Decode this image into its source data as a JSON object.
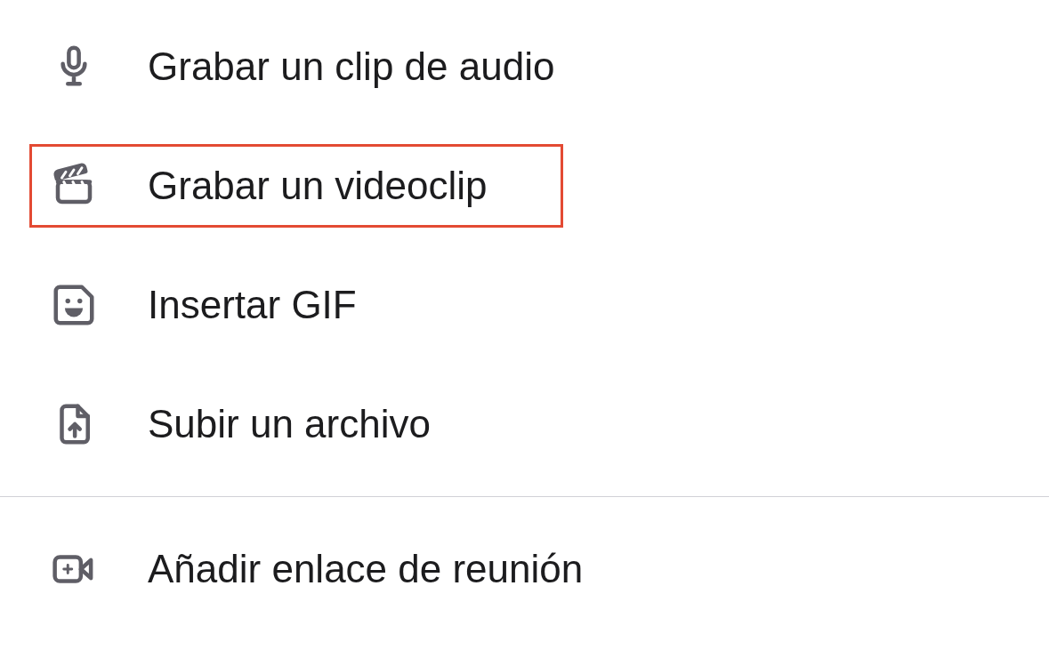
{
  "menu_groups": [
    {
      "items": [
        {
          "kind": "microphone",
          "label": "Grabar un clip de audio",
          "highlighted": false
        },
        {
          "kind": "clapperboard",
          "label": "Grabar un videoclip",
          "highlighted": true
        },
        {
          "kind": "gif",
          "label": "Insertar GIF",
          "highlighted": false
        },
        {
          "kind": "upload",
          "label": "Subir un archivo",
          "highlighted": false
        }
      ]
    },
    {
      "items": [
        {
          "kind": "meeting",
          "label": "Añadir enlace de reunión",
          "highlighted": false
        }
      ]
    }
  ]
}
